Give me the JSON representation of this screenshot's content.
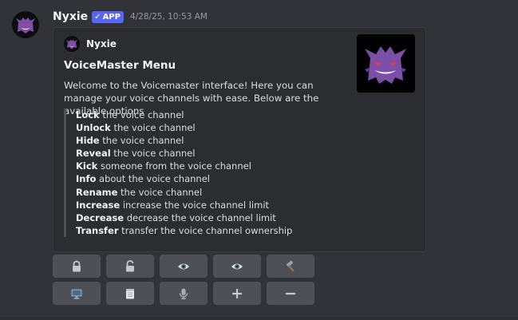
{
  "message": {
    "username": "Nyxie",
    "badge": "APP",
    "badge_check": "✓",
    "timestamp": "4/28/25, 10:53 AM",
    "avatar_icon": "gengar-avatar"
  },
  "embed": {
    "author": "Nyxie",
    "title": "VoiceMaster Menu",
    "description": "Welcome to the Voicemaster interface! Here you can manage your voice channels with ease. Below are the available options",
    "thumbnail_icon": "gengar-thumbnail",
    "options": [
      {
        "keyword": "Lock",
        "text": " the voice channel"
      },
      {
        "keyword": "Unlock",
        "text": " the voice channel"
      },
      {
        "keyword": "Hide",
        "text": " the voice channel"
      },
      {
        "keyword": "Reveal",
        "text": " the voice channel"
      },
      {
        "keyword": "Kick",
        "text": " someone from the voice channel"
      },
      {
        "keyword": "Info",
        "text": " about the voice channel"
      },
      {
        "keyword": "Rename",
        "text": " the voice channel"
      },
      {
        "keyword": "Increase",
        "text": " increase the voice channel limit"
      },
      {
        "keyword": "Decrease",
        "text": " decrease the voice channel limit"
      },
      {
        "keyword": "Transfer",
        "text": " transfer the voice channel ownership"
      }
    ]
  },
  "buttons": [
    {
      "name": "lock-button",
      "icon": "lock-icon"
    },
    {
      "name": "unlock-button",
      "icon": "unlock-icon"
    },
    {
      "name": "hide-button",
      "icon": "eye-icon"
    },
    {
      "name": "reveal-button",
      "icon": "eye-icon"
    },
    {
      "name": "kick-button",
      "icon": "hammer-icon"
    },
    {
      "name": "info-button",
      "icon": "monitor-icon"
    },
    {
      "name": "rename-button",
      "icon": "notepad-icon"
    },
    {
      "name": "transfer-button",
      "icon": "microphone-icon"
    },
    {
      "name": "increase-button",
      "icon": "plus-icon"
    },
    {
      "name": "decrease-button",
      "icon": "minus-icon"
    }
  ],
  "colors": {
    "background": "#323339",
    "embed_bg": "#2b2d31",
    "button_bg": "#4e5058",
    "badge": "#5865f2",
    "gengar": "#7b4fa8"
  }
}
